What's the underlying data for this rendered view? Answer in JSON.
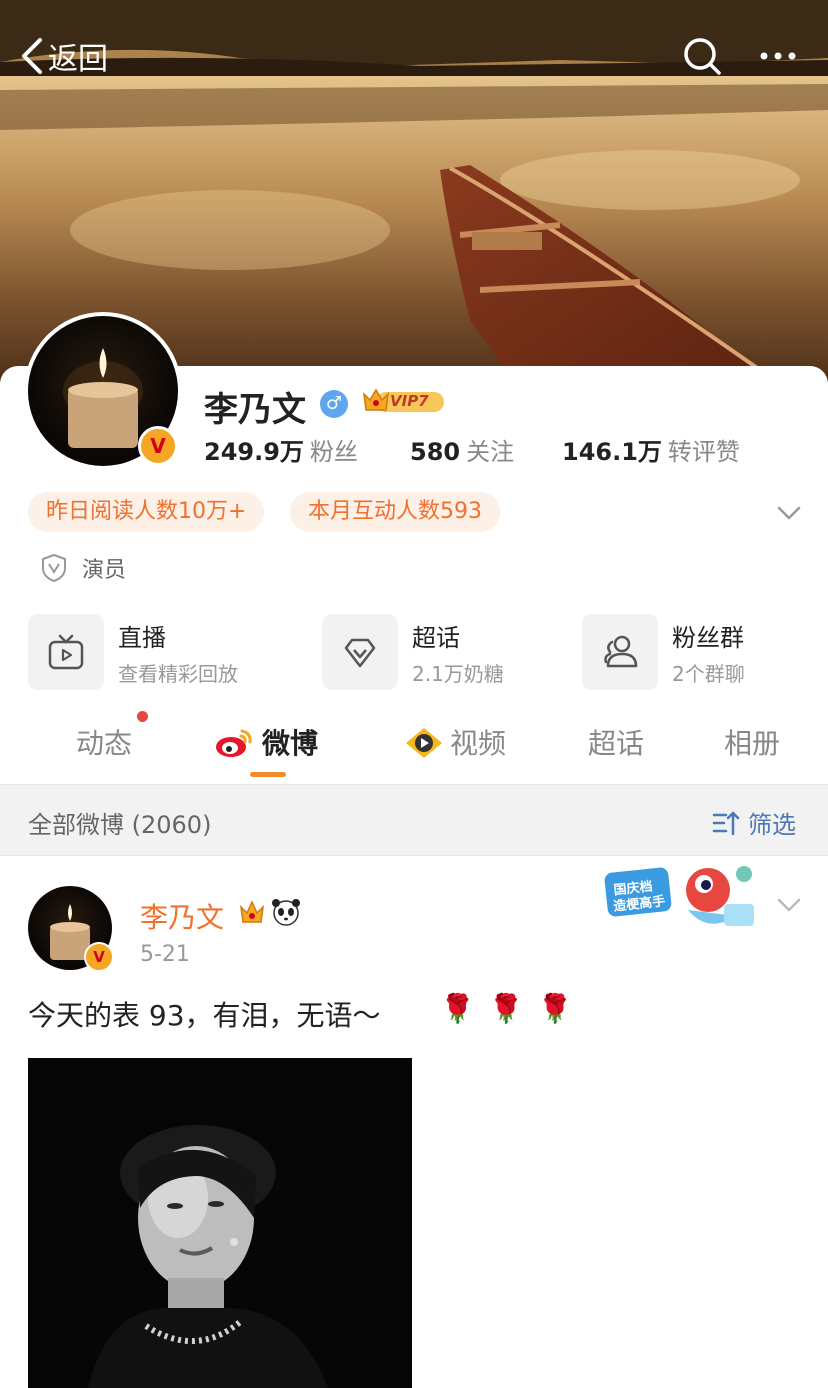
{
  "header": {
    "back_label": "返回",
    "icons": [
      "chevron-left-icon",
      "search-icon",
      "more-icon"
    ]
  },
  "profile": {
    "name": "李乃文",
    "gender_symbol": "♂",
    "vip_label": "VIP7",
    "verified_badge": "V",
    "stats": [
      {
        "value": "249.9万",
        "label": "粉丝"
      },
      {
        "value": "580",
        "label": "关注"
      },
      {
        "value": "146.1万",
        "label": "转评赞"
      }
    ],
    "chips": [
      "昨日阅读人数10万+",
      "本月互动人数593"
    ],
    "role": "演员"
  },
  "features": [
    {
      "title": "直播",
      "subtitle": "查看精彩回放",
      "icon": "tv-icon"
    },
    {
      "title": "超话",
      "subtitle": "2.1万奶糖",
      "icon": "diamond-icon"
    },
    {
      "title": "粉丝群",
      "subtitle": "2个群聊",
      "icon": "group-icon"
    }
  ],
  "tabs": [
    {
      "label": "动态",
      "active": false
    },
    {
      "label": "微博",
      "active": true
    },
    {
      "label": "视频",
      "active": false
    },
    {
      "label": "超话",
      "active": false
    },
    {
      "label": "相册",
      "active": false
    }
  ],
  "filter": {
    "title": "全部微博 (2060)",
    "button": "筛选"
  },
  "post": {
    "author": "李乃文",
    "date": "5-21",
    "text": "今天的表 93，有泪，无语～",
    "emoji": "🌹🌹🌹",
    "sticker_text": "国庆档 造梗高手"
  },
  "colors": {
    "accent_orange": "#f0702e",
    "link_blue": "#4a78b8",
    "chip_bg": "#fdf0e6",
    "tab_underline": "#f28a30"
  }
}
